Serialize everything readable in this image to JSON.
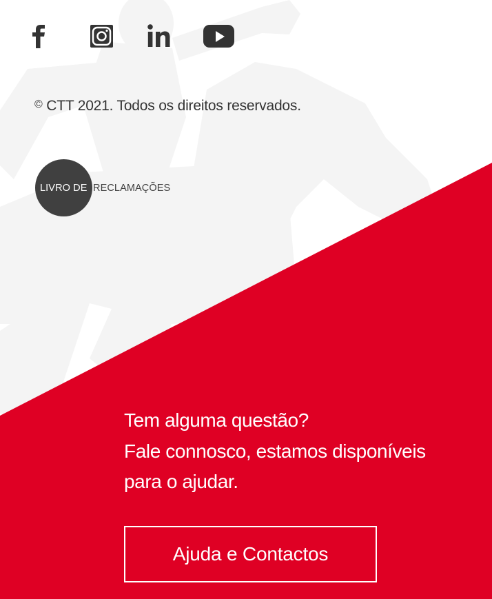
{
  "social": {
    "items": [
      {
        "name": "Facebook",
        "icon": "facebook-icon"
      },
      {
        "name": "Instagram",
        "icon": "instagram-icon"
      },
      {
        "name": "LinkedIn",
        "icon": "linkedin-icon"
      },
      {
        "name": "YouTube",
        "icon": "youtube-icon"
      }
    ]
  },
  "footer": {
    "copyright_symbol": "©",
    "copyright_text": "CTT 2021. Todos os direitos reservados."
  },
  "livro": {
    "part1": "LIVRO DE",
    "part2": "RECLAMAÇÕES"
  },
  "cta": {
    "line1": "Tem alguma questão?",
    "line2": "Fale connosco, estamos disponíveis",
    "line3": "para o ajudar.",
    "button_label": "Ajuda e Contactos"
  },
  "colors": {
    "brand_red": "#df0024",
    "text_dark": "#333333",
    "icon_dark": "#333333",
    "livro_grey": "#404040",
    "watermark": "#f4f4f4"
  }
}
